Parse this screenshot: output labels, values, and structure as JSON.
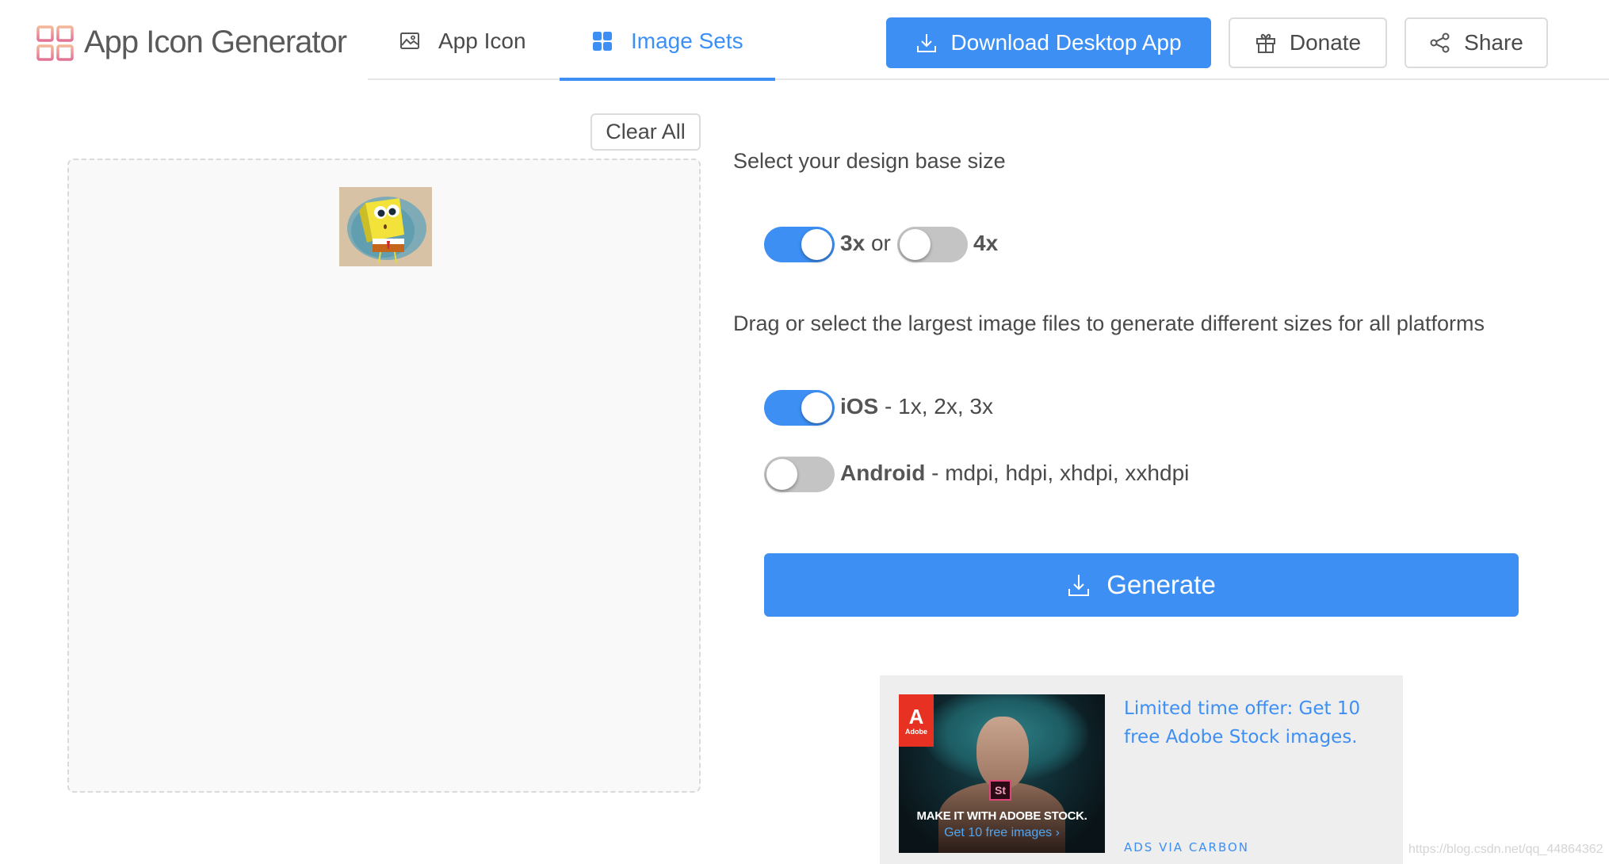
{
  "header": {
    "brand": "App Icon Generator",
    "tabs": [
      {
        "label": "App Icon",
        "icon": "image-icon",
        "active": false
      },
      {
        "label": "Image Sets",
        "icon": "grid-icon",
        "active": true
      }
    ],
    "buttons": {
      "download": "Download Desktop App",
      "donate": "Donate",
      "share": "Share"
    }
  },
  "left_panel": {
    "clear_all": "Clear All",
    "uploaded_images": [
      {
        "description": "SpongeBob thumbnail"
      }
    ]
  },
  "right_panel": {
    "base_size_label": "Select your design base size",
    "base_size": {
      "option_a": {
        "label": "3x",
        "on": true
      },
      "separator": "or",
      "option_b": {
        "label": "4x",
        "on": false
      }
    },
    "platforms_label": "Drag or select the largest image files to generate different sizes for all platforms",
    "platforms": [
      {
        "name": "iOS",
        "sizes": " - 1x, 2x, 3x",
        "on": true
      },
      {
        "name": "Android",
        "sizes": " - mdpi, hdpi, xhdpi, xxhdpi",
        "on": false
      }
    ],
    "generate": "Generate"
  },
  "ad": {
    "image_brand": "Adobe",
    "image_badge": "St",
    "image_headline": "MAKE IT WITH ADOBE STOCK.",
    "image_cta": "Get 10 free images ›",
    "text": "Limited time offer: Get 10 free Adobe Stock images.",
    "via": "ADS VIA CARBON"
  },
  "watermark": "https://blog.csdn.net/qq_44864362",
  "colors": {
    "accent": "#3d8ff4",
    "toggle_off": "#c4c4c4",
    "text": "#4a4a4a",
    "ad_bg": "#eeeeee"
  }
}
